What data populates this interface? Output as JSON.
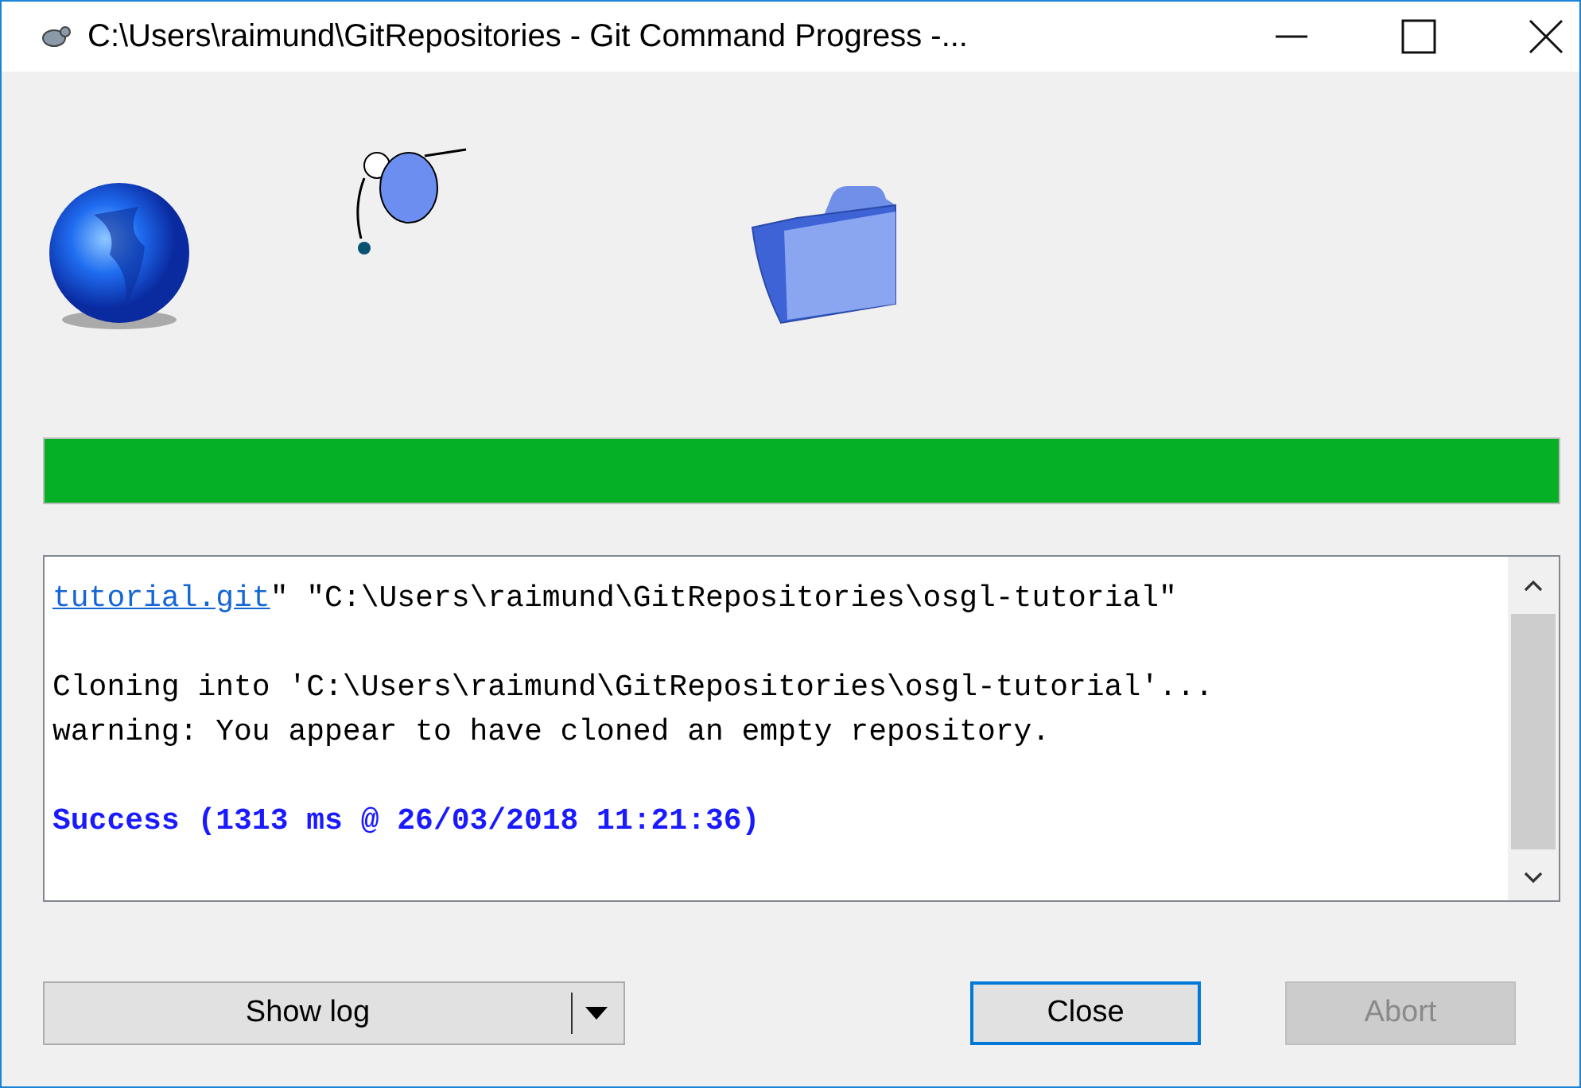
{
  "window": {
    "title": "C:\\Users\\raimund\\GitRepositories - Git Command Progress -..."
  },
  "progress": {
    "level": 1
  },
  "log": [
    {
      "kind": "command",
      "link": "tutorial.git",
      "text": "\" \"C:\\Users\\raimund\\GitRepositories\\osgl-tutorial\""
    },
    {
      "kind": "text",
      "text": "Cloning into 'C:\\Users\\raimund\\GitRepositories\\osgl-tutorial'..."
    },
    {
      "kind": "text",
      "text": "warning: You appear to have cloned an empty repository."
    },
    {
      "kind": "success",
      "text": "Success (1313 ms @ 26/03/2018 11:21:36)"
    }
  ],
  "buttons": [
    {
      "kind": "split",
      "label": "Show log",
      "disabled": false,
      "default": false
    },
    {
      "kind": "plain",
      "label": "Close",
      "disabled": false,
      "default": true
    },
    {
      "kind": "plain",
      "label": "Abort",
      "disabled": true,
      "default": false
    }
  ]
}
